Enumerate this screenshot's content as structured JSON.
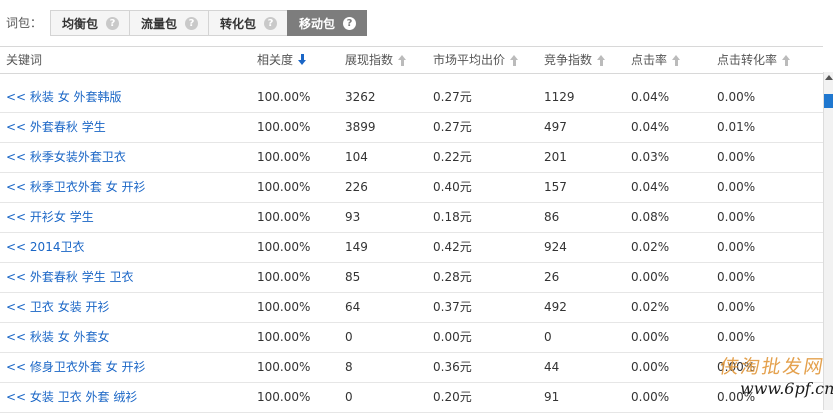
{
  "tabs": {
    "caption": "词包：",
    "items": [
      {
        "label": "均衡包",
        "help": "?"
      },
      {
        "label": "流量包",
        "help": "?"
      },
      {
        "label": "转化包",
        "help": "?"
      },
      {
        "label": "移动包",
        "help": "?",
        "active": true
      }
    ]
  },
  "table": {
    "columns": [
      "关键词",
      "相关度",
      "展现指数",
      "市场平均出价",
      "竞争指数",
      "点击率",
      "点击转化率"
    ],
    "sort": {
      "column": "相关度",
      "direction": "descending"
    },
    "rows": [
      {
        "keyword": "<< 秋装 女 外套韩版",
        "relevance": "100.00%",
        "impressions": "3262",
        "avg_bid": "0.27元",
        "competition": "1129",
        "ctr": "0.04%",
        "cvr": "0.00%"
      },
      {
        "keyword": "<< 外套春秋 学生",
        "relevance": "100.00%",
        "impressions": "3899",
        "avg_bid": "0.27元",
        "competition": "497",
        "ctr": "0.04%",
        "cvr": "0.01%"
      },
      {
        "keyword": "<< 秋季女装外套卫衣",
        "relevance": "100.00%",
        "impressions": "104",
        "avg_bid": "0.22元",
        "competition": "201",
        "ctr": "0.03%",
        "cvr": "0.00%"
      },
      {
        "keyword": "<< 秋季卫衣外套 女 开衫",
        "relevance": "100.00%",
        "impressions": "226",
        "avg_bid": "0.40元",
        "competition": "157",
        "ctr": "0.04%",
        "cvr": "0.00%"
      },
      {
        "keyword": "<< 开衫女 学生",
        "relevance": "100.00%",
        "impressions": "93",
        "avg_bid": "0.18元",
        "competition": "86",
        "ctr": "0.08%",
        "cvr": "0.00%"
      },
      {
        "keyword": "<< 2014卫衣",
        "relevance": "100.00%",
        "impressions": "149",
        "avg_bid": "0.42元",
        "competition": "924",
        "ctr": "0.02%",
        "cvr": "0.00%"
      },
      {
        "keyword": "<< 外套春秋 学生 卫衣",
        "relevance": "100.00%",
        "impressions": "85",
        "avg_bid": "0.28元",
        "competition": "26",
        "ctr": "0.00%",
        "cvr": "0.00%"
      },
      {
        "keyword": "<< 卫衣 女装 开衫",
        "relevance": "100.00%",
        "impressions": "64",
        "avg_bid": "0.37元",
        "competition": "492",
        "ctr": "0.02%",
        "cvr": "0.00%"
      },
      {
        "keyword": "<< 秋装 女 外套女",
        "relevance": "100.00%",
        "impressions": "0",
        "avg_bid": "0.00元",
        "competition": "0",
        "ctr": "0.00%",
        "cvr": "0.00%"
      },
      {
        "keyword": "<< 修身卫衣外套 女 开衫",
        "relevance": "100.00%",
        "impressions": "8",
        "avg_bid": "0.36元",
        "competition": "44",
        "ctr": "0.00%",
        "cvr": "0.00%"
      },
      {
        "keyword": "<< 女装 卫衣 外套 绒衫",
        "relevance": "100.00%",
        "impressions": "0",
        "avg_bid": "0.20元",
        "competition": "91",
        "ctr": "0.00%",
        "cvr": "0.00%"
      }
    ]
  },
  "watermark": {
    "line1": "侠淘批发网",
    "line2": "www.6pf.cn"
  },
  "colors": {
    "link": "#1a66c6",
    "active_tab": "#7d7d7d",
    "sort_active": "#1a66c6",
    "sort_idle": "#bbbbbb",
    "scrollbar_thumb": "#1f77cf"
  }
}
